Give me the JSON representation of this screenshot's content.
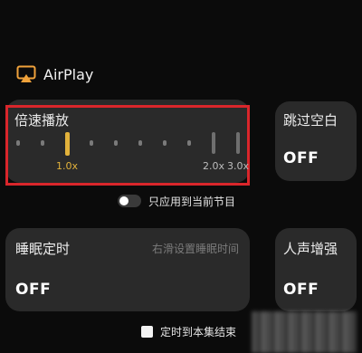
{
  "airplay": {
    "label": "AirPlay",
    "icon": "airplay-icon"
  },
  "speed": {
    "title": "倍速播放",
    "labels": [
      "1.0x",
      "2.0x",
      "3.0x"
    ]
  },
  "apply_toggle": {
    "label": "只应用到当前节目",
    "checked": false
  },
  "skip": {
    "title": "跳过空白",
    "value": "OFF"
  },
  "sleep": {
    "title": "睡眠定时",
    "hint": "右滑设置睡眠时间",
    "value": "OFF"
  },
  "voice": {
    "title": "人声增强",
    "value": "OFF"
  },
  "stop_option": {
    "label": "定时到本集结束",
    "checked": false
  },
  "colors": {
    "accent": "#e2b23b",
    "highlight_border": "#d9262b",
    "card_bg": "#2a2a2a",
    "page_bg": "#0b0b0b"
  }
}
